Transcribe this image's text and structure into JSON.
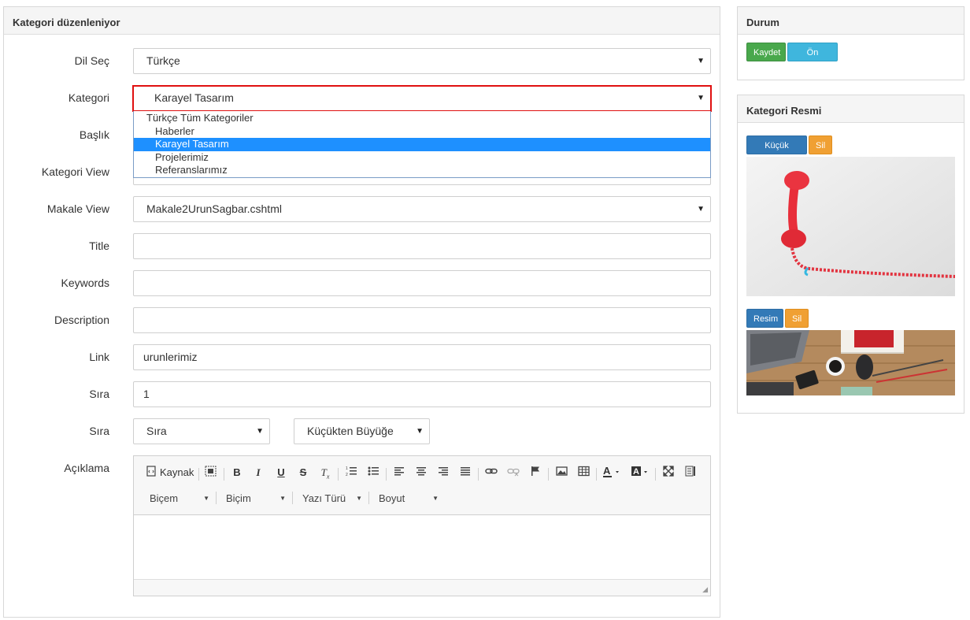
{
  "main_panel": {
    "title": "Kategori düzenleniyor"
  },
  "form": {
    "dil": {
      "label": "Dil Seç",
      "value": "Türkçe"
    },
    "kategori": {
      "label": "Kategori",
      "value": "Karayel Tasarım",
      "options": [
        {
          "label": "Türkçe Tüm Kategoriler",
          "group": true
        },
        {
          "label": "Haberler"
        },
        {
          "label": "Karayel Tasarım",
          "selected": true
        },
        {
          "label": "Projelerimiz"
        },
        {
          "label": "Referanslarımız"
        }
      ]
    },
    "baslik": {
      "label": "Başlık"
    },
    "kategori_view": {
      "label": "Kategori View"
    },
    "makale_view": {
      "label": "Makale View",
      "value": "Makale2UrunSagbar.cshtml"
    },
    "title": {
      "label": "Title",
      "value": ""
    },
    "keywords": {
      "label": "Keywords",
      "value": ""
    },
    "description": {
      "label": "Description",
      "value": ""
    },
    "link": {
      "label": "Link",
      "value": "urunlerimiz"
    },
    "sira": {
      "label": "Sıra",
      "value": "1"
    },
    "sira2": {
      "label": "Sıra",
      "value": "Sıra",
      "order": "Küçükten Büyüğe"
    },
    "aciklama": {
      "label": "Açıklama"
    }
  },
  "editor": {
    "source_label": "Kaynak",
    "combo1": "Biçem",
    "combo2": "Biçim",
    "combo3": "Yazı Türü",
    "combo4": "Boyut"
  },
  "durum_panel": {
    "title": "Durum",
    "save_label": "Kaydet",
    "preview_label": "Ön İzleme"
  },
  "resim_panel": {
    "title": "Kategori Resmi",
    "small_image_label": "Küçük Resim",
    "delete_label": "Sil",
    "image_label": "Resim"
  },
  "colors": {
    "highlight": "#e01010",
    "selected_option": "#1e90ff",
    "save": "#49a84c",
    "preview": "#3fb6dd",
    "primary": "#337ab7",
    "warning": "#f0a033"
  }
}
